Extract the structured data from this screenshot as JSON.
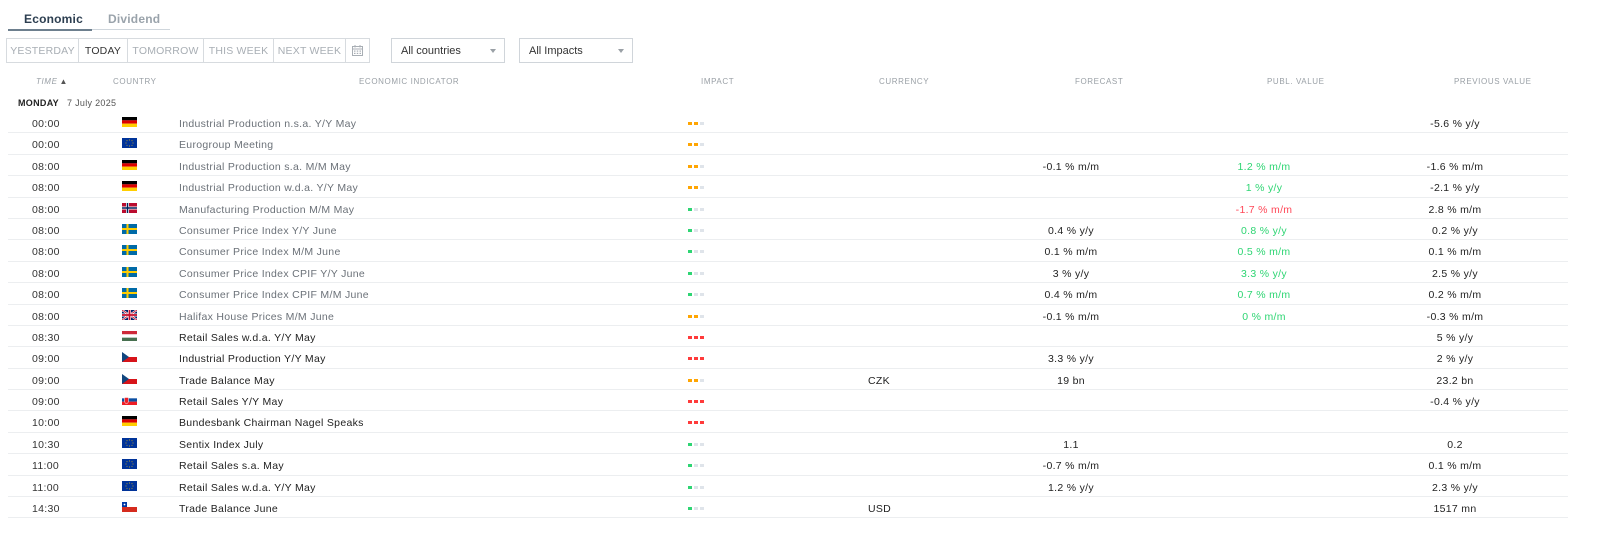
{
  "tabs": [
    {
      "label": "Economic",
      "active": true
    },
    {
      "label": "Dividend",
      "active": false
    }
  ],
  "day_filters": [
    {
      "label": "YESTERDAY",
      "active": false
    },
    {
      "label": "TODAY",
      "active": true
    },
    {
      "label": "TOMORROW",
      "active": false
    },
    {
      "label": "THIS WEEK",
      "active": false
    },
    {
      "label": "NEXT WEEK",
      "active": false
    }
  ],
  "calendar_icon": "calendar-icon",
  "country_select": {
    "value": "All countries"
  },
  "impact_select": {
    "value": "All Impacts"
  },
  "columns": {
    "time": "TIME",
    "country": "COUNTRY",
    "indicator": "ECONOMIC INDICATOR",
    "impact": "IMPACT",
    "currency": "CURRENCY",
    "forecast": "FORECAST",
    "published": "PUBL. VALUE",
    "previous": "PREVIOUS VALUE"
  },
  "sort_icon": "sort-up-icon",
  "date_header": {
    "day": "MONDAY",
    "date": "7 July 2025"
  },
  "colors": {
    "positive": "#2ed573",
    "negative": "#ff4757",
    "impact_low": "#2ed573",
    "impact_medium": "#ffa502",
    "impact_high": "#ff3b3b",
    "impact_off": "#dfe4ea"
  },
  "events": [
    {
      "time": "00:00",
      "country": "DE",
      "indicator": "Industrial Production n.s.a. Y/Y May",
      "impact": "medium",
      "currency": "",
      "forecast": "",
      "published": "",
      "pub_dir": "",
      "previous": "-5.6 % y/y",
      "dim": true
    },
    {
      "time": "00:00",
      "country": "EU",
      "indicator": "Eurogroup Meeting",
      "impact": "medium",
      "currency": "",
      "forecast": "",
      "published": "",
      "pub_dir": "",
      "previous": "",
      "dim": true
    },
    {
      "time": "08:00",
      "country": "DE",
      "indicator": "Industrial Production s.a. M/M May",
      "impact": "medium",
      "currency": "",
      "forecast": "-0.1 % m/m",
      "published": "1.2 % m/m",
      "pub_dir": "pos",
      "previous": "-1.6 % m/m",
      "dim": true
    },
    {
      "time": "08:00",
      "country": "DE",
      "indicator": "Industrial Production w.d.a. Y/Y May",
      "impact": "medium",
      "currency": "",
      "forecast": "",
      "published": "1 % y/y",
      "pub_dir": "pos",
      "previous": "-2.1 % y/y",
      "dim": true
    },
    {
      "time": "08:00",
      "country": "NO",
      "indicator": "Manufacturing Production M/M May",
      "impact": "low",
      "currency": "",
      "forecast": "",
      "published": "-1.7 % m/m",
      "pub_dir": "neg",
      "previous": "2.8 % m/m",
      "dim": true
    },
    {
      "time": "08:00",
      "country": "SE",
      "indicator": "Consumer Price Index Y/Y June",
      "impact": "low",
      "currency": "",
      "forecast": "0.4 % y/y",
      "published": "0.8 % y/y",
      "pub_dir": "pos",
      "previous": "0.2 % y/y",
      "dim": true
    },
    {
      "time": "08:00",
      "country": "SE",
      "indicator": "Consumer Price Index M/M June",
      "impact": "low",
      "currency": "",
      "forecast": "0.1 % m/m",
      "published": "0.5 % m/m",
      "pub_dir": "pos",
      "previous": "0.1 % m/m",
      "dim": true
    },
    {
      "time": "08:00",
      "country": "SE",
      "indicator": "Consumer Price Index CPIF Y/Y June",
      "impact": "low",
      "currency": "",
      "forecast": "3 % y/y",
      "published": "3.3 % y/y",
      "pub_dir": "pos",
      "previous": "2.5 % y/y",
      "dim": true
    },
    {
      "time": "08:00",
      "country": "SE",
      "indicator": "Consumer Price Index CPIF M/M June",
      "impact": "low",
      "currency": "",
      "forecast": "0.4 % m/m",
      "published": "0.7 % m/m",
      "pub_dir": "pos",
      "previous": "0.2 % m/m",
      "dim": true
    },
    {
      "time": "08:00",
      "country": "GB",
      "indicator": "Halifax House Prices M/M June",
      "impact": "medium",
      "currency": "",
      "forecast": "-0.1 % m/m",
      "published": "0 % m/m",
      "pub_dir": "pos",
      "previous": "-0.3 % m/m",
      "dim": true
    },
    {
      "time": "08:30",
      "country": "HU",
      "indicator": "Retail Sales w.d.a. Y/Y May",
      "impact": "high",
      "currency": "",
      "forecast": "",
      "published": "",
      "pub_dir": "",
      "previous": "5 % y/y",
      "dim": false
    },
    {
      "time": "09:00",
      "country": "CZ",
      "indicator": "Industrial Production Y/Y May",
      "impact": "high",
      "currency": "",
      "forecast": "3.3 % y/y",
      "published": "",
      "pub_dir": "",
      "previous": "2 % y/y",
      "dim": false
    },
    {
      "time": "09:00",
      "country": "CZ",
      "indicator": "Trade Balance May",
      "impact": "medium",
      "currency": "CZK",
      "forecast": "19 bn",
      "published": "",
      "pub_dir": "",
      "previous": "23.2 bn",
      "dim": false
    },
    {
      "time": "09:00",
      "country": "SK",
      "indicator": "Retail Sales Y/Y May",
      "impact": "high",
      "currency": "",
      "forecast": "",
      "published": "",
      "pub_dir": "",
      "previous": "-0.4 % y/y",
      "dim": false
    },
    {
      "time": "10:00",
      "country": "DE",
      "indicator": "Bundesbank Chairman Nagel Speaks",
      "impact": "high",
      "currency": "",
      "forecast": "",
      "published": "",
      "pub_dir": "",
      "previous": "",
      "dim": false
    },
    {
      "time": "10:30",
      "country": "EU",
      "indicator": "Sentix Index July",
      "impact": "low",
      "currency": "",
      "forecast": "1.1",
      "published": "",
      "pub_dir": "",
      "previous": "0.2",
      "dim": false
    },
    {
      "time": "11:00",
      "country": "EU",
      "indicator": "Retail Sales s.a. May",
      "impact": "low",
      "currency": "",
      "forecast": "-0.7 % m/m",
      "published": "",
      "pub_dir": "",
      "previous": "0.1 % m/m",
      "dim": false
    },
    {
      "time": "11:00",
      "country": "EU",
      "indicator": "Retail Sales w.d.a. Y/Y May",
      "impact": "low",
      "currency": "",
      "forecast": "1.2 % y/y",
      "published": "",
      "pub_dir": "",
      "previous": "2.3 % y/y",
      "dim": false
    },
    {
      "time": "14:30",
      "country": "CL",
      "indicator": "Trade Balance June",
      "impact": "low",
      "currency": "USD",
      "forecast": "",
      "published": "",
      "pub_dir": "",
      "previous": "1517 mn",
      "dim": false
    }
  ]
}
